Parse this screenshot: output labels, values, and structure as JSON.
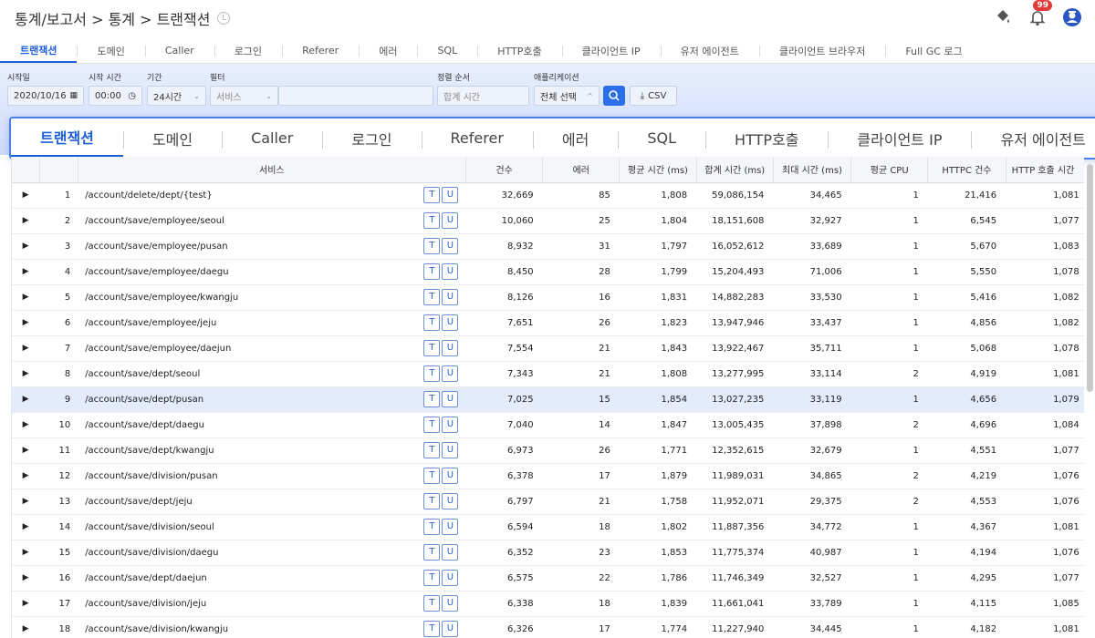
{
  "header": {
    "breadcrumb": "통계/보고서 > 통계 > 트랜잭션",
    "notification_count": "99"
  },
  "tabs": [
    {
      "label": "트랜잭션",
      "active": true
    },
    {
      "label": "도메인"
    },
    {
      "label": "Caller"
    },
    {
      "label": "로그인"
    },
    {
      "label": "Referer"
    },
    {
      "label": "에러"
    },
    {
      "label": "SQL"
    },
    {
      "label": "HTTP호출"
    },
    {
      "label": "클라이언트 IP"
    },
    {
      "label": "유저 에이전트"
    },
    {
      "label": "클라이언트 브라우저"
    },
    {
      "label": "Full GC 로그"
    }
  ],
  "filters": {
    "start_date_label": "시작일",
    "start_date": "2020/10/16",
    "start_time_label": "시작 시간",
    "start_time": "00:00",
    "period_label": "기간",
    "period": "24시간",
    "filter_label": "필터",
    "filter_type": "서비스",
    "filter_value": "",
    "sort_label": "정렬 순서",
    "sort_value": "합계 시간",
    "app_label": "애플리케이션",
    "app_value": "전체 선택",
    "csv_label": "CSV"
  },
  "zoom_tabs": [
    "트랜잭션",
    "도메인",
    "Caller",
    "로그인",
    "Referer",
    "에러",
    "SQL",
    "HTTP호출",
    "클라이언트 IP",
    "유저 에이전트"
  ],
  "table": {
    "columns": [
      "서비스",
      "건수",
      "에러",
      "평균 시간 (ms)",
      "합계 시간 (ms)",
      "최대 시간 (ms)",
      "평균 CPU",
      "HTTPC 건수",
      "HTTP 호출 시간"
    ],
    "chip_t": "T",
    "chip_u": "U",
    "rows": [
      {
        "idx": "1",
        "service": "/account/delete/dept/{test}",
        "count": "32,669",
        "errors": "85",
        "avg": "1,808",
        "sum": "59,086,154",
        "max": "34,465",
        "cpu": "1",
        "httpc": "21,416",
        "http_time": "1,081"
      },
      {
        "idx": "2",
        "service": "/account/save/employee/seoul",
        "count": "10,060",
        "errors": "25",
        "avg": "1,804",
        "sum": "18,151,608",
        "max": "32,927",
        "cpu": "1",
        "httpc": "6,545",
        "http_time": "1,077"
      },
      {
        "idx": "3",
        "service": "/account/save/employee/pusan",
        "count": "8,932",
        "errors": "31",
        "avg": "1,797",
        "sum": "16,052,612",
        "max": "33,689",
        "cpu": "1",
        "httpc": "5,670",
        "http_time": "1,083"
      },
      {
        "idx": "4",
        "service": "/account/save/employee/daegu",
        "count": "8,450",
        "errors": "28",
        "avg": "1,799",
        "sum": "15,204,493",
        "max": "71,006",
        "cpu": "1",
        "httpc": "5,550",
        "http_time": "1,078"
      },
      {
        "idx": "5",
        "service": "/account/save/employee/kwangju",
        "count": "8,126",
        "errors": "16",
        "avg": "1,831",
        "sum": "14,882,283",
        "max": "33,530",
        "cpu": "1",
        "httpc": "5,416",
        "http_time": "1,082"
      },
      {
        "idx": "6",
        "service": "/account/save/employee/jeju",
        "count": "7,651",
        "errors": "26",
        "avg": "1,823",
        "sum": "13,947,946",
        "max": "33,437",
        "cpu": "1",
        "httpc": "4,856",
        "http_time": "1,082"
      },
      {
        "idx": "7",
        "service": "/account/save/employee/daejun",
        "count": "7,554",
        "errors": "21",
        "avg": "1,843",
        "sum": "13,922,467",
        "max": "35,711",
        "cpu": "1",
        "httpc": "5,068",
        "http_time": "1,078"
      },
      {
        "idx": "8",
        "service": "/account/save/dept/seoul",
        "count": "7,343",
        "errors": "21",
        "avg": "1,808",
        "sum": "13,277,995",
        "max": "33,114",
        "cpu": "2",
        "httpc": "4,919",
        "http_time": "1,081"
      },
      {
        "idx": "9",
        "service": "/account/save/dept/pusan",
        "count": "7,025",
        "errors": "15",
        "avg": "1,854",
        "sum": "13,027,235",
        "max": "33,119",
        "cpu": "1",
        "httpc": "4,656",
        "http_time": "1,079",
        "selected": true
      },
      {
        "idx": "10",
        "service": "/account/save/dept/daegu",
        "count": "7,040",
        "errors": "14",
        "avg": "1,847",
        "sum": "13,005,435",
        "max": "37,898",
        "cpu": "2",
        "httpc": "4,696",
        "http_time": "1,084"
      },
      {
        "idx": "11",
        "service": "/account/save/dept/kwangju",
        "count": "6,973",
        "errors": "26",
        "avg": "1,771",
        "sum": "12,352,615",
        "max": "32,679",
        "cpu": "1",
        "httpc": "4,551",
        "http_time": "1,077"
      },
      {
        "idx": "12",
        "service": "/account/save/division/pusan",
        "count": "6,378",
        "errors": "17",
        "avg": "1,879",
        "sum": "11,989,031",
        "max": "34,865",
        "cpu": "2",
        "httpc": "4,219",
        "http_time": "1,076"
      },
      {
        "idx": "13",
        "service": "/account/save/dept/jeju",
        "count": "6,797",
        "errors": "21",
        "avg": "1,758",
        "sum": "11,952,071",
        "max": "29,375",
        "cpu": "2",
        "httpc": "4,553",
        "http_time": "1,076"
      },
      {
        "idx": "14",
        "service": "/account/save/division/seoul",
        "count": "6,594",
        "errors": "18",
        "avg": "1,802",
        "sum": "11,887,356",
        "max": "34,772",
        "cpu": "1",
        "httpc": "4,367",
        "http_time": "1,081"
      },
      {
        "idx": "15",
        "service": "/account/save/division/daegu",
        "count": "6,352",
        "errors": "23",
        "avg": "1,853",
        "sum": "11,775,374",
        "max": "40,987",
        "cpu": "1",
        "httpc": "4,194",
        "http_time": "1,076"
      },
      {
        "idx": "16",
        "service": "/account/save/dept/daejun",
        "count": "6,575",
        "errors": "22",
        "avg": "1,786",
        "sum": "11,746,349",
        "max": "32,527",
        "cpu": "1",
        "httpc": "4,295",
        "http_time": "1,077"
      },
      {
        "idx": "17",
        "service": "/account/save/division/jeju",
        "count": "6,338",
        "errors": "18",
        "avg": "1,839",
        "sum": "11,661,041",
        "max": "33,789",
        "cpu": "1",
        "httpc": "4,115",
        "http_time": "1,085"
      },
      {
        "idx": "18",
        "service": "/account/save/division/kwangju",
        "count": "6,326",
        "errors": "17",
        "avg": "1,774",
        "sum": "11,227,940",
        "max": "34,445",
        "cpu": "1",
        "httpc": "4,182",
        "http_time": "1,081"
      }
    ]
  }
}
